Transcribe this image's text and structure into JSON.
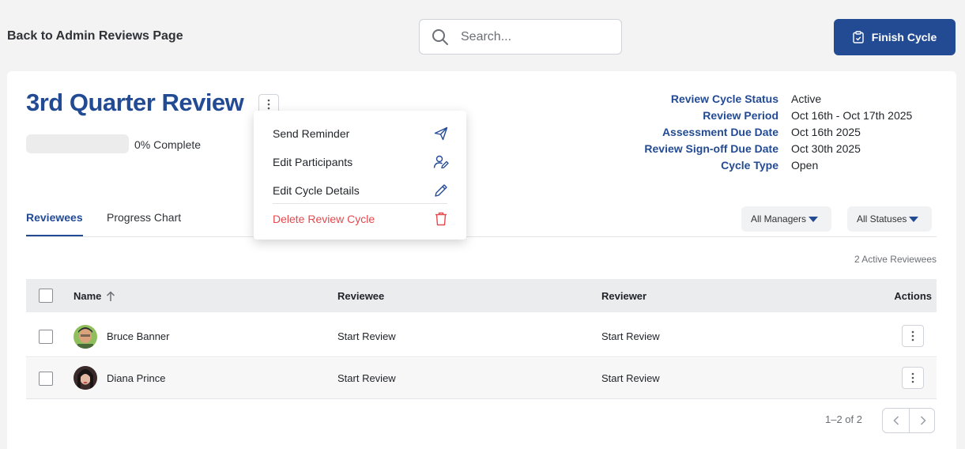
{
  "header": {
    "back_label": "Back to Admin Reviews Page",
    "search_placeholder": "Search...",
    "finish_label": "Finish Cycle"
  },
  "review": {
    "title": "3rd Quarter Review",
    "progress": 0,
    "progress_label": "0% Complete"
  },
  "meta": [
    {
      "label": "Review Cycle Status",
      "value": "Active"
    },
    {
      "label": "Review Period",
      "value": "Oct 16th - Oct 17th 2025"
    },
    {
      "label": "Assessment Due Date",
      "value": "Oct 16th 2025"
    },
    {
      "label": "Review Sign-off Due Date",
      "value": "Oct 30th 2025"
    },
    {
      "label": "Cycle Type",
      "value": "Open"
    }
  ],
  "tabs": [
    {
      "label": "Reviewees",
      "active": true
    },
    {
      "label": "Progress Chart",
      "active": false
    }
  ],
  "filters": {
    "managers": "All Managers",
    "statuses": "All Statuses"
  },
  "active_count": "2 Active Reviewees",
  "table": {
    "headers": {
      "name": "Name",
      "reviewee": "Reviewee",
      "reviewer": "Reviewer",
      "actions": "Actions"
    },
    "rows": [
      {
        "name": "Bruce Banner",
        "reviewee": "Start Review",
        "reviewer": "Start Review"
      },
      {
        "name": "Diana Prince",
        "reviewee": "Start Review",
        "reviewer": "Start Review"
      }
    ]
  },
  "pagination": {
    "label": "1–2 of 2"
  },
  "menu": {
    "items": [
      {
        "label": "Send Reminder",
        "icon": "paper-plane-icon"
      },
      {
        "label": "Edit Participants",
        "icon": "user-edit-icon"
      },
      {
        "label": "Edit Cycle Details",
        "icon": "pencil-icon"
      },
      {
        "label": "Delete Review Cycle",
        "icon": "trash-icon"
      }
    ]
  },
  "colors": {
    "brand": "#234b94",
    "danger": "#e5484d"
  }
}
